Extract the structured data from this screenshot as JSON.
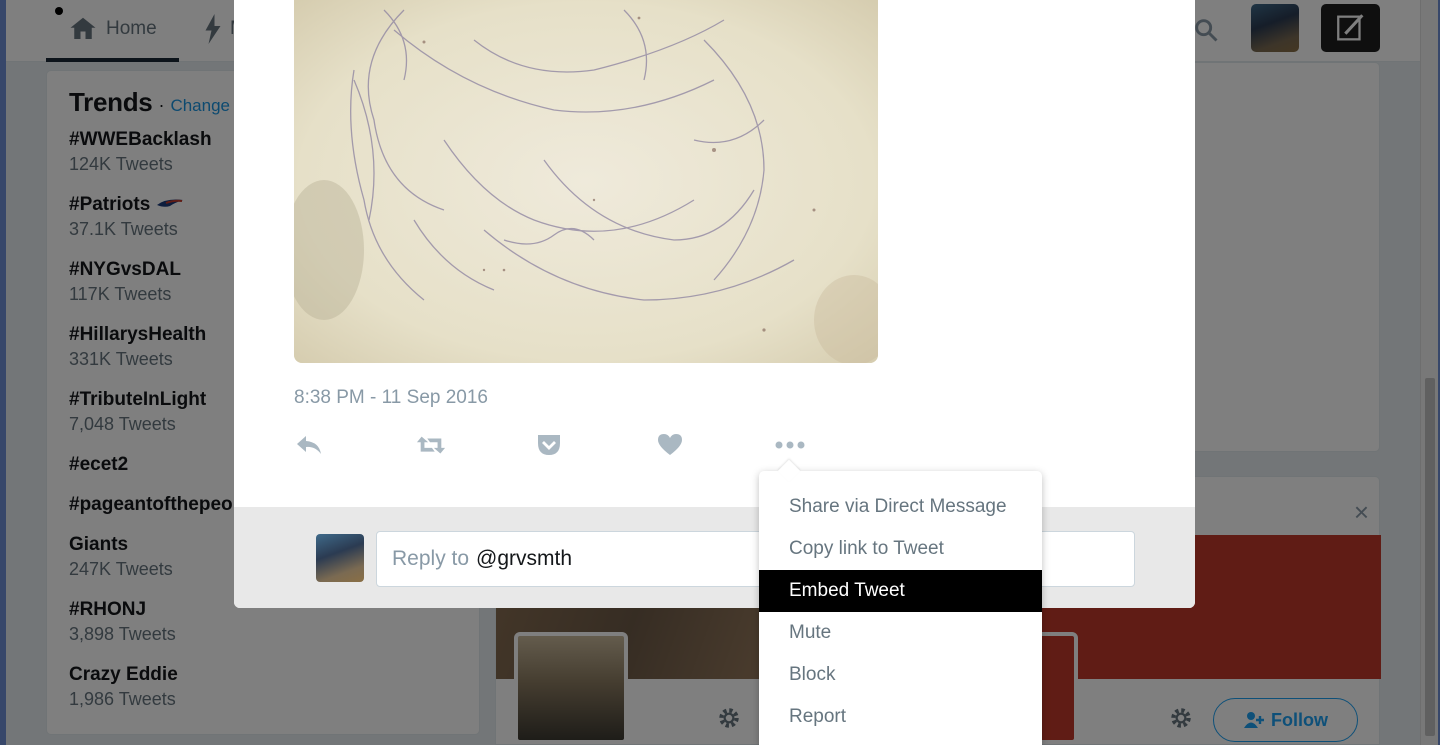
{
  "nav": {
    "home_label": "Home",
    "moments_initial": "M"
  },
  "trends": {
    "title": "Trends",
    "separator": "·",
    "change_label": "Change",
    "items": [
      {
        "name": "#WWEBacklash",
        "count": "124K Tweets"
      },
      {
        "name": "#Patriots",
        "count": "37.1K Tweets"
      },
      {
        "name": "#NYGvsDAL",
        "count": "117K Tweets"
      },
      {
        "name": "#HillarysHealth",
        "count": "331K Tweets"
      },
      {
        "name": "#TributeInLight",
        "count": "7,048 Tweets"
      },
      {
        "name": "#ecet2",
        "count": ""
      },
      {
        "name": "#pageantofthepeo",
        "count": ""
      },
      {
        "name": "Giants",
        "count": "247K Tweets"
      },
      {
        "name": "#RHONJ",
        "count": "3,898 Tweets"
      },
      {
        "name": "Crazy Eddie",
        "count": "1,986 Tweets"
      }
    ]
  },
  "tweet": {
    "timestamp": "8:38 PM - 11 Sep 2016"
  },
  "reply": {
    "placeholder": "Reply to",
    "handle": "@grvsmth"
  },
  "menu": {
    "items": [
      {
        "label": "Share via Direct Message"
      },
      {
        "label": "Copy link to Tweet"
      },
      {
        "label": "Embed Tweet"
      },
      {
        "label": "Mute"
      },
      {
        "label": "Block"
      },
      {
        "label": "Report"
      }
    ],
    "highlighted_index": 2
  },
  "who_to_follow": {
    "follow_label": "Follow"
  },
  "colors": {
    "accent": "#1da1f2",
    "muted": "#8899a6",
    "menu_highlight": "#000000"
  }
}
